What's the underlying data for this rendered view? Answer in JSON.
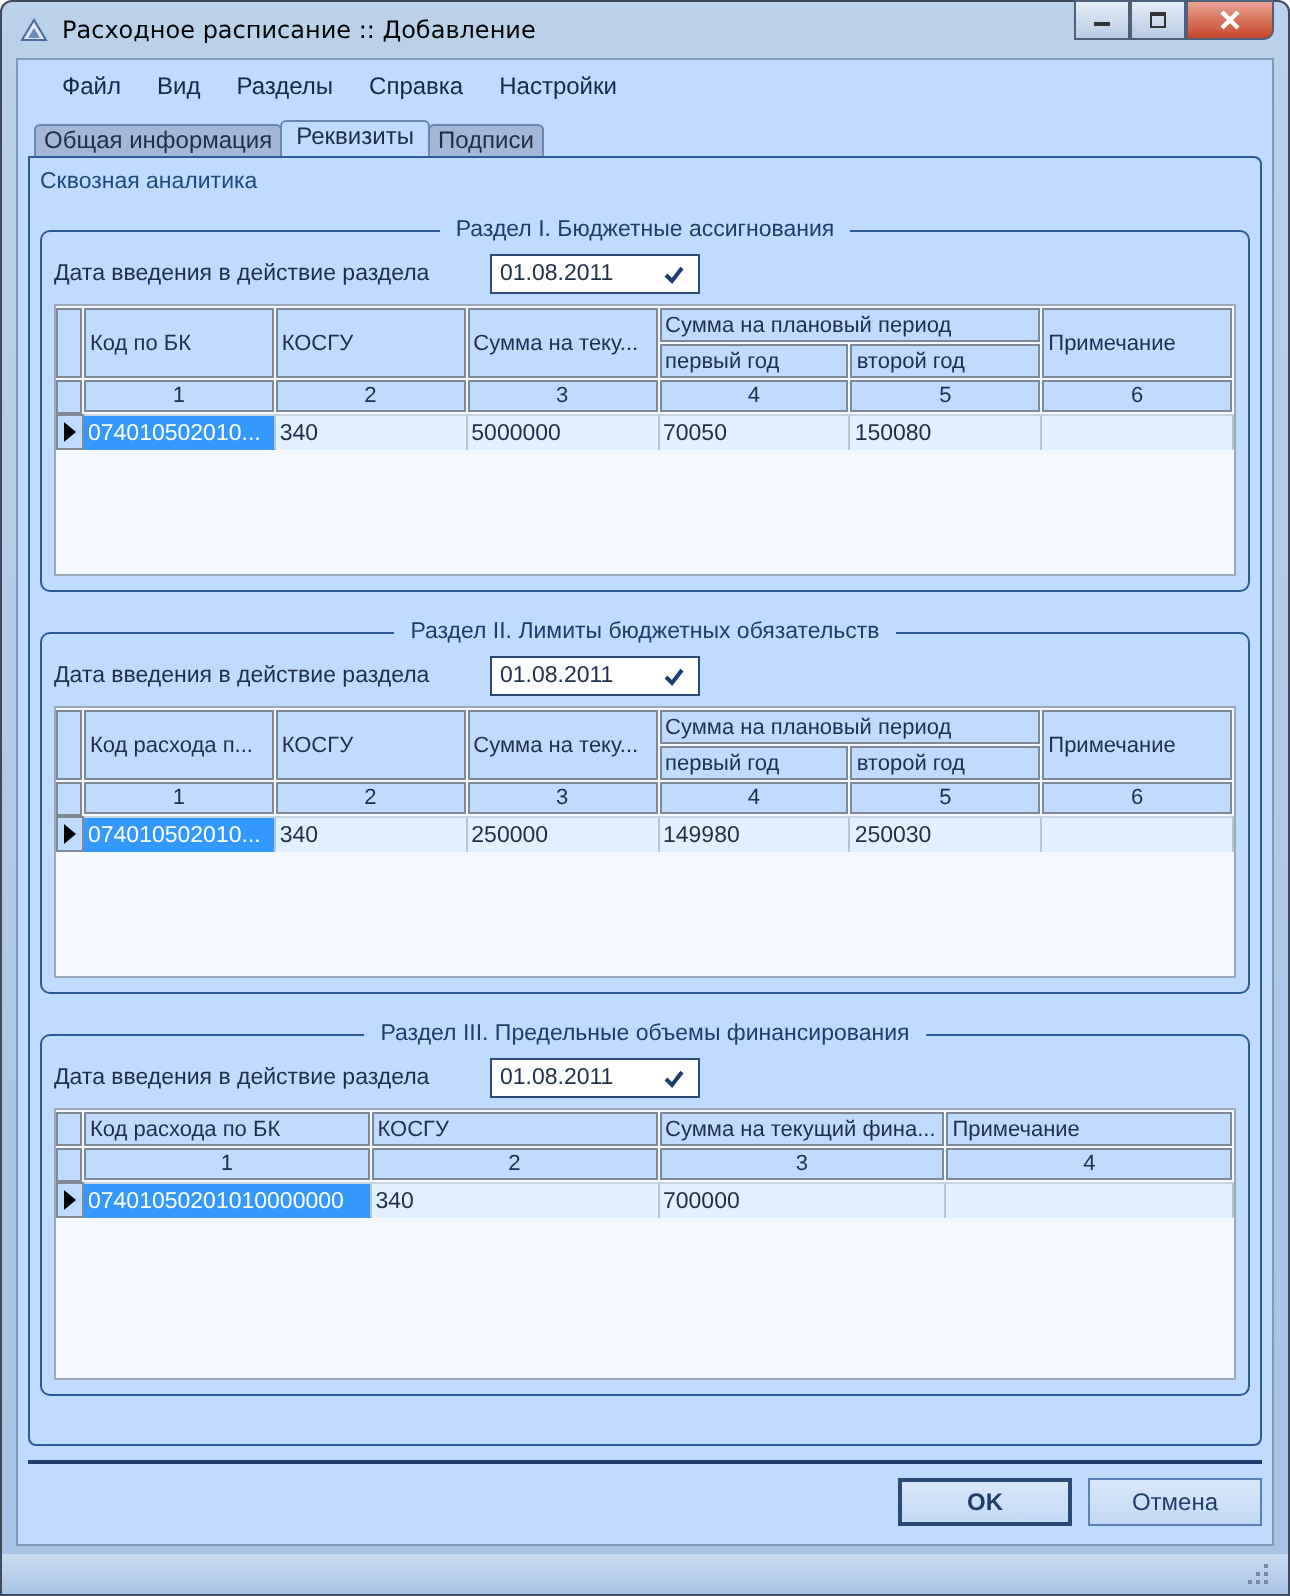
{
  "window": {
    "title": "Расходное расписание :: Добавление"
  },
  "menu": [
    "Файл",
    "Вид",
    "Разделы",
    "Справка",
    "Настройки"
  ],
  "tabs": [
    {
      "label": "Общая информация",
      "selected": false
    },
    {
      "label": "Реквизиты",
      "selected": true
    },
    {
      "label": "Подписи",
      "selected": false
    }
  ],
  "panel_title": "Сквозная аналитика",
  "sections": [
    {
      "title": "Раздел I. Бюджетные ассигнования",
      "date_label": "Дата введения в действие раздела",
      "date": "01.08.2011",
      "columns": [
        {
          "label": "Код по БК"
        },
        {
          "label": "КОСГУ"
        },
        {
          "label": "Сумма на теку..."
        },
        {
          "label": "первый год",
          "group": "Сумма на плановый период"
        },
        {
          "label": "второй год",
          "in_group": true
        },
        {
          "label": "Примечание"
        }
      ],
      "numbers": [
        "1",
        "2",
        "3",
        "4",
        "5",
        "6"
      ],
      "rows": [
        {
          "selected": true,
          "cells": [
            "074010502010...",
            "340",
            "5000000",
            "70050",
            "150080",
            ""
          ]
        }
      ]
    },
    {
      "title": "Раздел II. Лимиты бюджетных обязательств",
      "date_label": "Дата введения в действие раздела",
      "date": "01.08.2011",
      "columns": [
        {
          "label": "Код расхода п..."
        },
        {
          "label": "КОСГУ"
        },
        {
          "label": "Сумма на теку..."
        },
        {
          "label": "первый год",
          "group": "Сумма на плановый период"
        },
        {
          "label": "второй год",
          "in_group": true
        },
        {
          "label": "Примечание"
        }
      ],
      "numbers": [
        "1",
        "2",
        "3",
        "4",
        "5",
        "6"
      ],
      "rows": [
        {
          "selected": true,
          "cells": [
            "074010502010...",
            "340",
            "250000",
            "149980",
            "250030",
            ""
          ]
        }
      ]
    },
    {
      "title": "Раздел III. Предельные объемы финансирования",
      "date_label": "Дата введения в действие раздела",
      "date": "01.08.2011",
      "columns": [
        {
          "label": "Код расхода по БК"
        },
        {
          "label": "КОСГУ"
        },
        {
          "label": "Сумма на текущий фина..."
        },
        {
          "label": "Примечание"
        }
      ],
      "numbers": [
        "1",
        "2",
        "3",
        "4"
      ],
      "rows": [
        {
          "selected": true,
          "cells": [
            "07401050201010000000",
            "340",
            "700000",
            ""
          ]
        }
      ]
    }
  ],
  "buttons": [
    {
      "label": "OK",
      "default": true
    },
    {
      "label": "Отмена",
      "default": false
    }
  ]
}
